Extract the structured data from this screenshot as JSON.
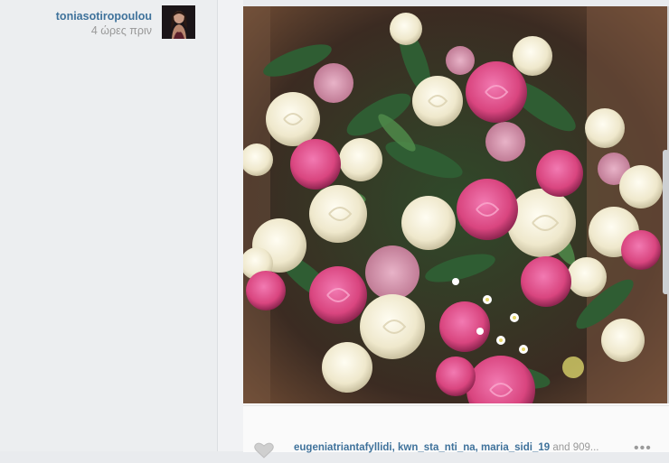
{
  "post": {
    "username": "toniasotiropoulou",
    "time_ago": "4 ώρες πριν"
  },
  "footer": {
    "likers_names": "eugeniatriantafyllidi, kwn_sta_nti_na, maria_sidi_19",
    "likers_rest": " and 909...",
    "more_label": "•••"
  },
  "icons": {
    "like": "heart-icon",
    "more": "more-options-icon"
  },
  "colors": {
    "link": "#3f729b",
    "muted": "#999999"
  }
}
